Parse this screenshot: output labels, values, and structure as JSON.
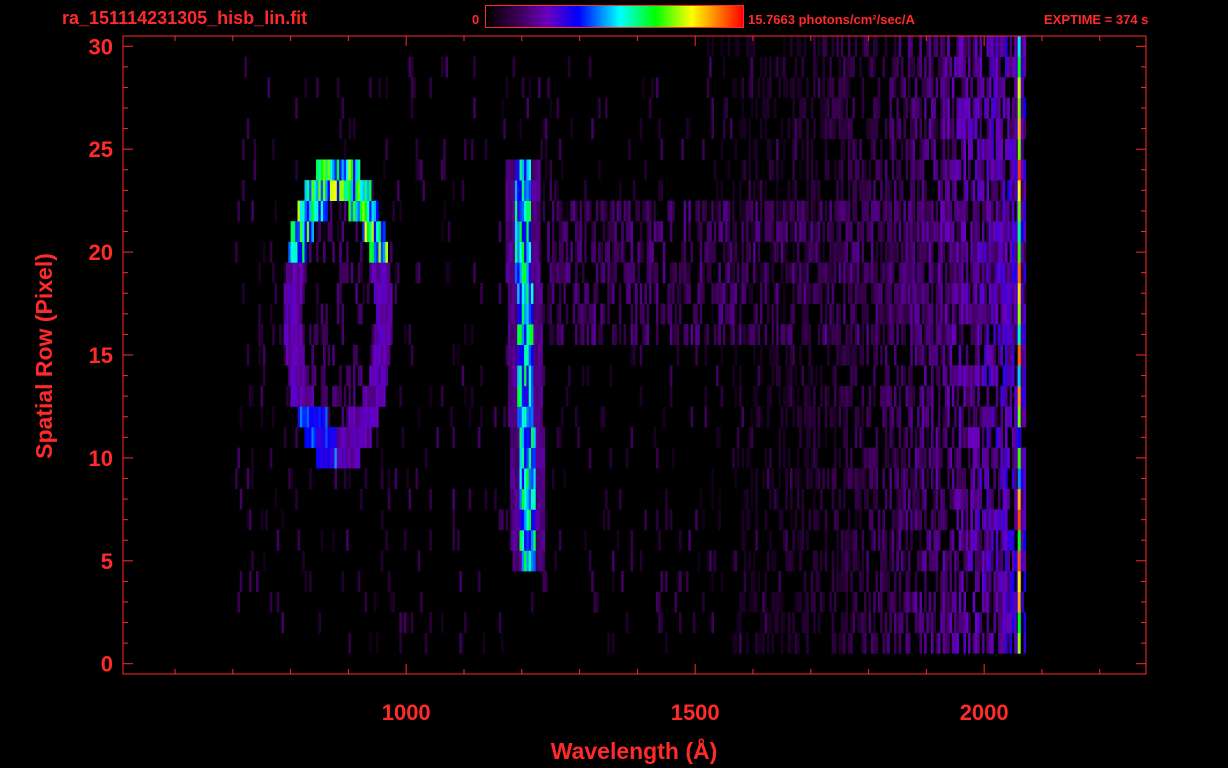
{
  "header": {
    "file_name": "ra_151114231305_hisb_lin.fit",
    "colorbar_min": "0",
    "colorbar_max_label": "15.7663 photons/cm²/sec/A",
    "exptime": "EXPTIME = 374 s"
  },
  "colors": {
    "axis": "#ff2a2a",
    "background": "#000000",
    "colormap": [
      "#000000",
      "#3a0050",
      "#6a00c0",
      "#0000ff",
      "#00ffff",
      "#00ff00",
      "#ffff00",
      "#ff8000",
      "#ff0000"
    ]
  },
  "chart_data": {
    "type": "heatmap",
    "xlabel": "Wavelength (Å)",
    "ylabel": "Spatial Row (Pixel)",
    "xlim": [
      510,
      2280
    ],
    "ylim": [
      -0.5,
      30.5
    ],
    "x_ticks": [
      1000,
      1500,
      2000
    ],
    "y_ticks": [
      0,
      5,
      10,
      15,
      20,
      25,
      30
    ],
    "grid": false,
    "colorbar": {
      "min": 0,
      "max": 15.7663,
      "units": "photons/cm²/sec/A"
    },
    "features": [
      {
        "name": "Lyman-beta ring upper arc",
        "x": [
          840,
          950
        ],
        "rows": [
          20,
          24
        ],
        "level": 0.6
      },
      {
        "name": "Lyman-beta ring left edge",
        "x": [
          820,
          870
        ],
        "rows": [
          10,
          20
        ],
        "level": 0.3
      },
      {
        "name": "Lyman-beta ring right edge",
        "x": [
          900,
          1000
        ],
        "rows": [
          10,
          21
        ],
        "level": 0.2
      },
      {
        "name": "Lyman-alpha line",
        "x": [
          1195,
          1235
        ],
        "rows": [
          5,
          24
        ],
        "level": 0.5
      },
      {
        "name": "red continuum",
        "x": [
          1800,
          2065
        ],
        "rows": [
          1,
          30
        ],
        "level": 0.25
      }
    ]
  }
}
